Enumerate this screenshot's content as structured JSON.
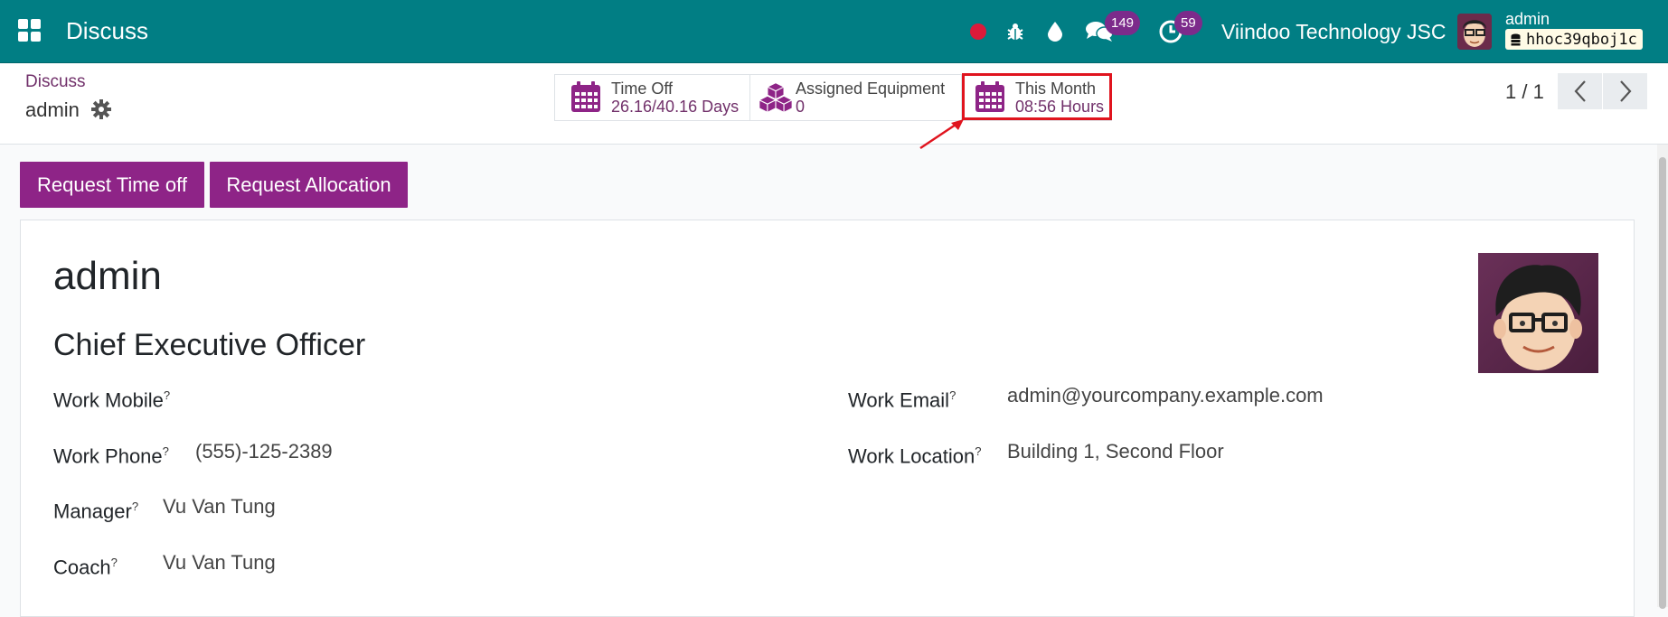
{
  "topbar": {
    "app_title": "Discuss",
    "messages_count": "149",
    "activities_count": "59",
    "company": "Viindoo Technology JSC",
    "user_name": "admin",
    "db_name": "hhoc39qboj1c"
  },
  "breadcrumb": {
    "parent": "Discuss",
    "current": "admin"
  },
  "smart_buttons": [
    {
      "label": "Time Off",
      "value": "26.16/40.16 Days",
      "icon": "calendar-icon"
    },
    {
      "label": "Assigned Equipment",
      "value": "0",
      "icon": "cubes-icon"
    },
    {
      "label": "This Month",
      "value": "08:56 Hours",
      "icon": "calendar-icon"
    }
  ],
  "pager": {
    "value": "1 / 1"
  },
  "actions": {
    "request_time_off": "Request Time off",
    "request_allocation": "Request Allocation"
  },
  "employee": {
    "name": "admin",
    "job_title": "Chief Executive Officer",
    "fields": {
      "work_mobile": {
        "label": "Work Mobile",
        "value": ""
      },
      "work_phone": {
        "label": "Work Phone",
        "value": "(555)-125-2389"
      },
      "manager": {
        "label": "Manager",
        "value": "Vu Van Tung"
      },
      "coach": {
        "label": "Coach",
        "value": "Vu Van Tung"
      },
      "work_email": {
        "label": "Work Email",
        "value": "admin@yourcompany.example.com"
      },
      "work_location": {
        "label": "Work Location",
        "value": "Building 1, Second Floor"
      }
    },
    "help_mark": "?"
  },
  "colors": {
    "navbar": "#017e84",
    "brand_purple": "#8e2487",
    "link_purple": "#71306a",
    "highlight_red": "#e0141e",
    "record_dot": "#dc1a3a"
  }
}
